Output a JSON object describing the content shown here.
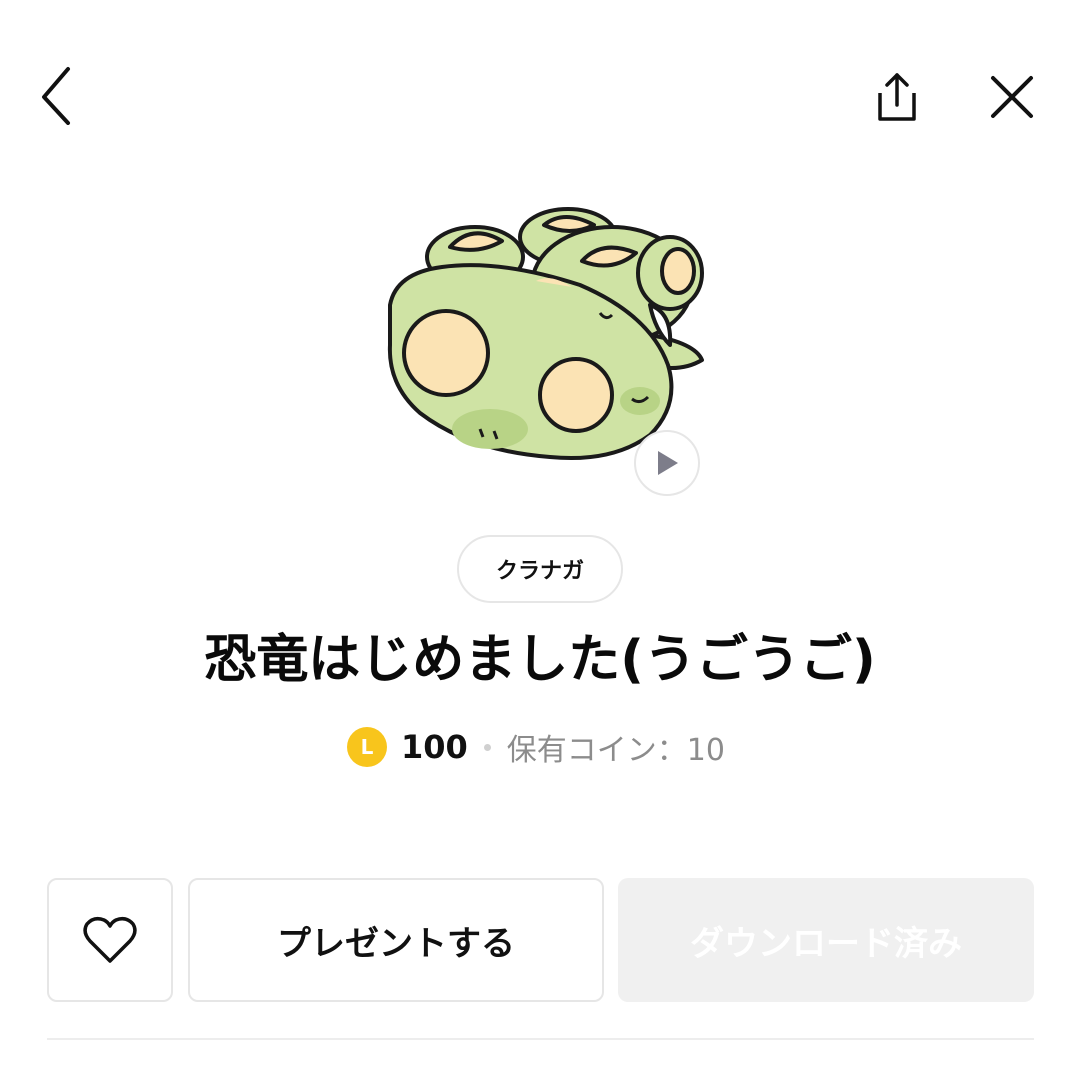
{
  "header": {
    "back_icon": "chevron-left-icon",
    "share_icon": "share-icon",
    "close_icon": "close-icon"
  },
  "sticker": {
    "image": "green-dinosaur-sticker",
    "play_icon": "play-icon"
  },
  "product": {
    "author": "クラナガ",
    "title": "恐竜はじめました(うごうご)",
    "coin_symbol": "L",
    "price": "100",
    "owned_coins": "保有コイン：10"
  },
  "actions": {
    "favorite_icon": "heart-icon",
    "gift_label": "プレゼントする",
    "download_label": "ダウンロード済み"
  },
  "colors": {
    "coin": "#f8c51c",
    "sticker_green": "#cfe3a4",
    "sticker_cream": "#fbe3b4",
    "disabled_button": "#f0f0f0"
  }
}
